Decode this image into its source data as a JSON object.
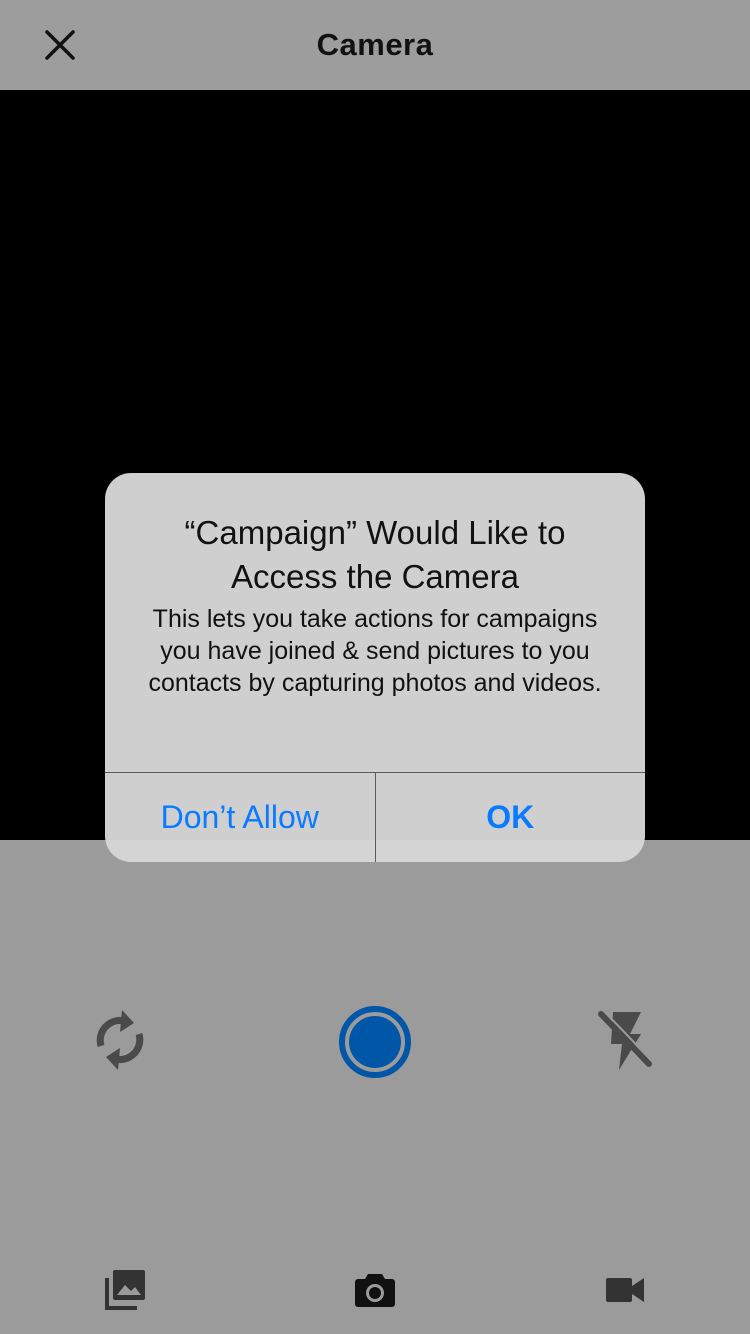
{
  "header": {
    "title": "Camera",
    "close_icon": "close-icon"
  },
  "alert": {
    "title": "“Campaign” Would Like to Access the Camera",
    "message": "This lets you take actions for campaigns you have joined & send pictures to you contacts by capturing photos and videos.",
    "deny_label": "Don’t Allow",
    "ok_label": "OK",
    "button_color": "#0a7aff"
  },
  "controls": {
    "switch_camera_icon": "switch-camera-icon",
    "shutter_icon": "shutter-icon",
    "flash_icon": "flash-off-icon",
    "shutter_color": "#0057a8"
  },
  "tabs": {
    "gallery_icon": "gallery-icon",
    "photo_icon": "camera-icon",
    "video_icon": "video-camera-icon"
  }
}
